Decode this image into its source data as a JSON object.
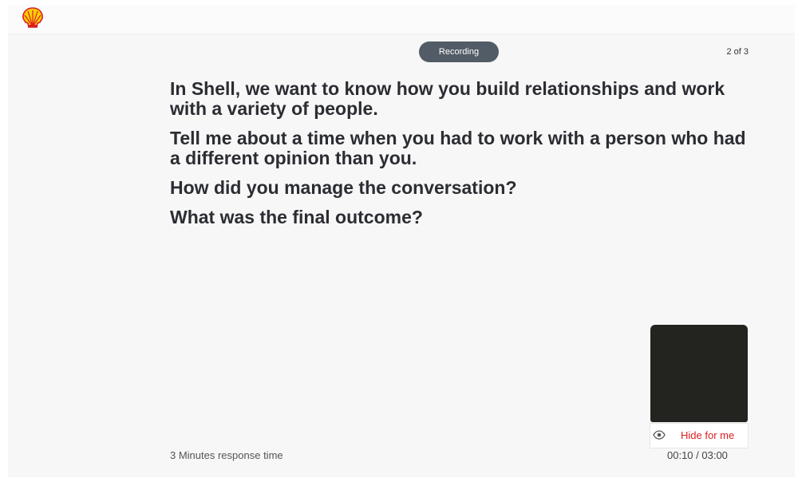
{
  "header": {
    "logo_icon": "shell-logo",
    "brand_colors": {
      "yellow": "#fbce07",
      "red": "#dd1d21"
    }
  },
  "status": {
    "recording_label": "Recording",
    "question_counter": "2 of 3"
  },
  "question": {
    "paragraphs": [
      "In Shell, we want to know how you build relationships and work with a variety of people.",
      "Tell me about a time when you had to work with a person who had a different opinion than you.",
      "How did you manage the conversation?",
      "What was the final outcome?"
    ]
  },
  "video": {
    "hide_label": "Hide for me",
    "hide_icon": "eye-icon"
  },
  "footer": {
    "response_time": "3 Minutes response time",
    "timer": "00:10 / 03:00"
  }
}
